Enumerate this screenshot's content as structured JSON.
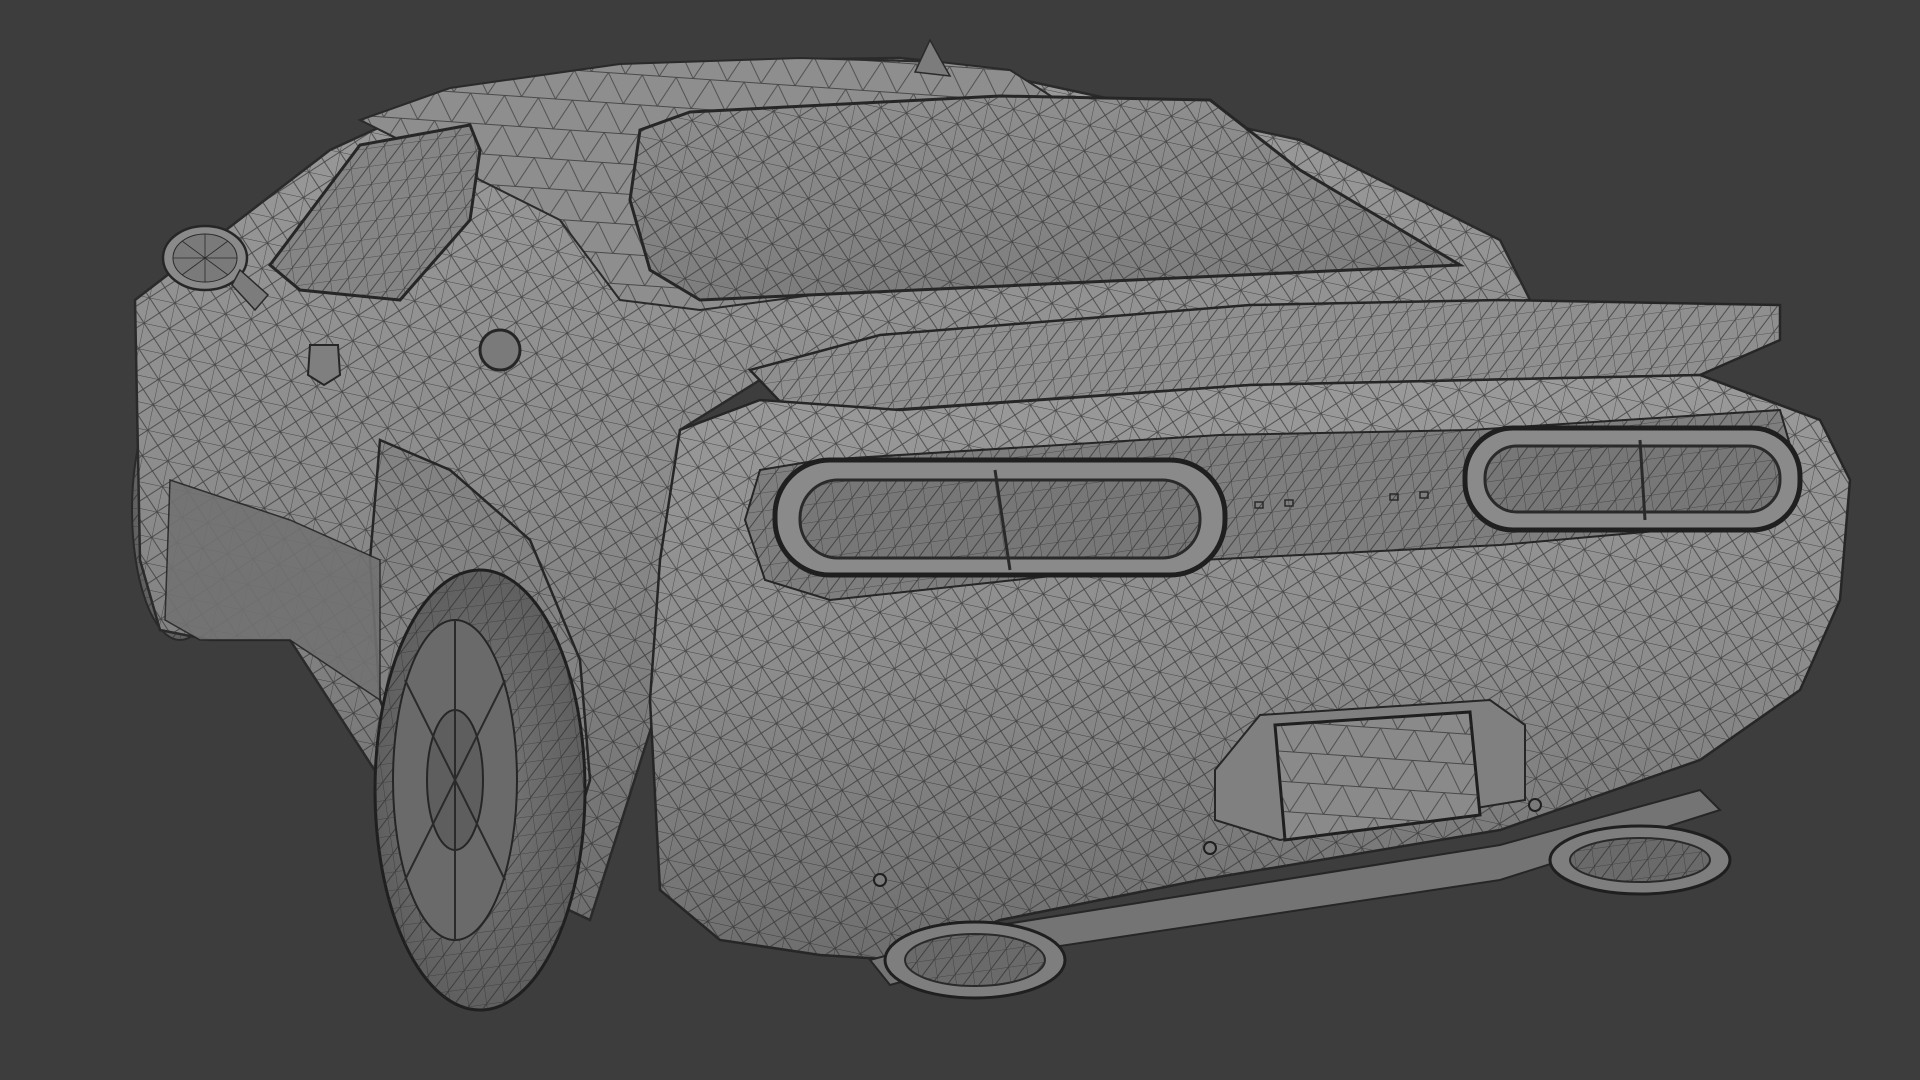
{
  "app": {
    "kind": "3d-viewport"
  },
  "viewport": {
    "background_color": "#3d3d3d",
    "shading_mode": "solid-wireframe",
    "object": "car-rear-three-quarter",
    "colors": {
      "body_fill": "#8b8b8b",
      "body_shadow": "#5c5c5c",
      "body_highlight": "#a3a3a3",
      "wire": "#2a2a2a",
      "tire": "#6f6f6f"
    }
  }
}
